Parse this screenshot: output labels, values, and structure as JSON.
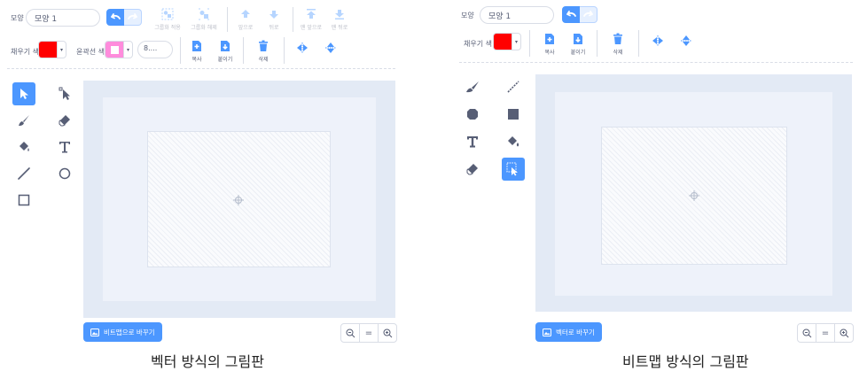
{
  "vector": {
    "costume_label": "모양",
    "costume_name": "모양 1",
    "group_label": "그룹화 적용",
    "ungroup_label": "그룹화 해제",
    "forward_label": "앞으로",
    "backward_label": "뒤로",
    "front_label": "맨 앞으로",
    "back_label": "맨 뒤로",
    "fill_label": "채우기 색",
    "outline_label": "윤곽선 색",
    "outline_width": "8....",
    "copy_label": "복사",
    "paste_label": "붙이기",
    "delete_label": "삭제",
    "convert_button": "비트맵으로 바꾸기",
    "zoom_reset": "=",
    "caption": "벡터 방식의 그림판"
  },
  "bitmap": {
    "costume_label": "모양",
    "costume_name": "모양 1",
    "fill_label": "채우기 색",
    "copy_label": "복사",
    "paste_label": "붙이기",
    "delete_label": "삭제",
    "convert_button": "벡터로 바꾸기",
    "zoom_reset": "=",
    "caption": "비트맵 방식의 그림판"
  },
  "colors": {
    "accent": "#4c97ff",
    "fill": "#ff0000",
    "outline": "#ff8cdc",
    "stage": "#e3eaf5"
  }
}
